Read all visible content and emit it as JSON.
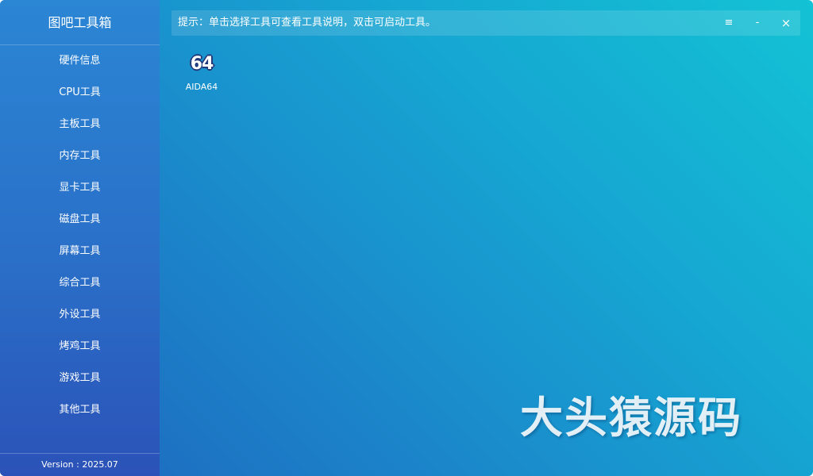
{
  "app": {
    "title": "图吧工具箱",
    "version": "Version : 2025.07"
  },
  "sidebar": {
    "items": [
      {
        "label": "硬件信息"
      },
      {
        "label": "CPU工具"
      },
      {
        "label": "主板工具"
      },
      {
        "label": "内存工具"
      },
      {
        "label": "显卡工具"
      },
      {
        "label": "磁盘工具"
      },
      {
        "label": "屏幕工具"
      },
      {
        "label": "综合工具"
      },
      {
        "label": "外设工具"
      },
      {
        "label": "烤鸡工具"
      },
      {
        "label": "游戏工具"
      },
      {
        "label": "其他工具"
      }
    ]
  },
  "hint": {
    "text": "提示：单击选择工具可查看工具说明，双击可启动工具。"
  },
  "window_controls": {
    "menu": "≡",
    "minimize": "-",
    "close": "×"
  },
  "tools": [
    {
      "icon_text": "64",
      "icon": "aida64-icon",
      "label": "AIDA64"
    }
  ],
  "watermark": "大头猿源码",
  "colors": {
    "sidebar": "#2a6fc8",
    "background_start": "#13c2d4",
    "background_end": "#1f64bd",
    "text": "#ffffff"
  }
}
